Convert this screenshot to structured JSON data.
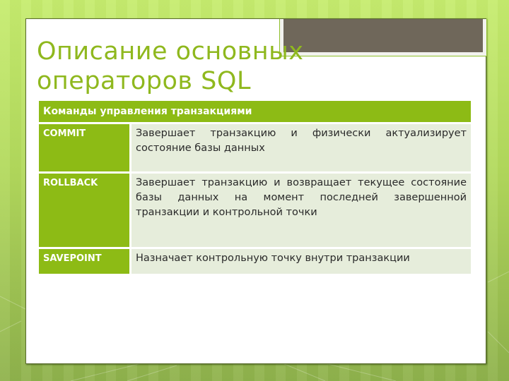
{
  "slide": {
    "title_lines": [
      "Описание основных",
      "операторов SQL"
    ]
  },
  "table": {
    "header": "Команды управления транзакциями",
    "rows": [
      {
        "command": "COMMIT",
        "description": "Завершает транзакцию и физически актуализирует состояние базы данных"
      },
      {
        "command": "ROLLBACK",
        "description": "Завершает транзакцию и возвращает текущее состояние базы данных на момент последней завершенной транзакции и контрольной точки"
      },
      {
        "command": "SAVEPOINT",
        "description": "Назначает контрольную точку внутри транзакции"
      }
    ]
  },
  "colors": {
    "accent": "#8dbb15",
    "title": "#8fb81e",
    "cell_bg": "#e6eddb",
    "photo_placeholder": "#6f675a"
  }
}
